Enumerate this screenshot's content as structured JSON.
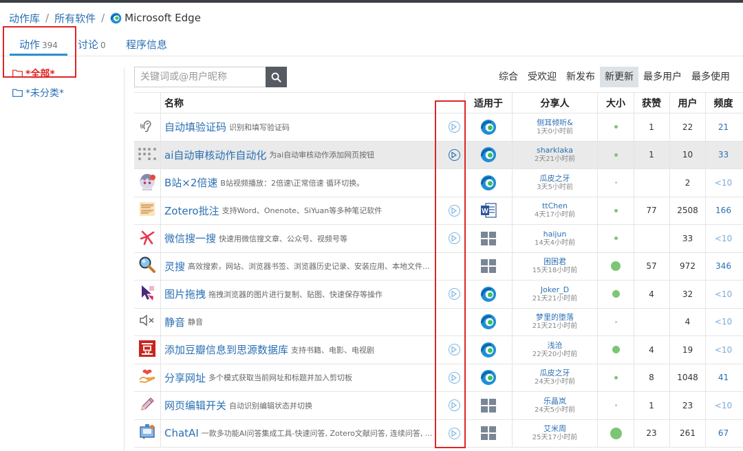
{
  "breadcrumb": {
    "root": "动作库",
    "mid": "所有软件",
    "current": "Microsoft Edge",
    "sep": "/"
  },
  "tabs": [
    {
      "label": "动作",
      "count": "394"
    },
    {
      "label": "讨论",
      "count": "0"
    },
    {
      "label": "程序信息",
      "count": ""
    }
  ],
  "sidebar": {
    "all": "*全部*",
    "uncategorized": "*未分类*"
  },
  "search": {
    "placeholder": "关键词或@用户昵称"
  },
  "sorts": [
    "综合",
    "受欢迎",
    "新发布",
    "新更新",
    "最多用户",
    "最多使用"
  ],
  "active_sort": "新更新",
  "headers": {
    "name": "名称",
    "for": "适用于",
    "sharer": "分享人",
    "size": "大小",
    "likes": "获赞",
    "users": "用户",
    "freq": "频度"
  },
  "colors": {
    "link": "#2a6fb3",
    "highlight": "#e02424",
    "dot": "#7cc576"
  },
  "rows": [
    {
      "icon": "ear-icon",
      "title": "自动填验证码",
      "desc": "识别和填写验证码",
      "play": true,
      "app": "edge",
      "sharer": "侧耳倾听&",
      "time": "1天0小时前",
      "size": "small",
      "likes": "1",
      "users": "22",
      "freq": "21"
    },
    {
      "icon": "grid-dots-icon",
      "title": "ai自动审核动作自动化",
      "desc": "为ai自动审核动作添加网页按钮",
      "play": true,
      "app": "edge",
      "sharer": "sharklaka",
      "time": "2天21小时前",
      "size": "small",
      "likes": "1",
      "users": "10",
      "freq": "33"
    },
    {
      "icon": "anime-icon",
      "title": "B站×2倍速",
      "desc": "B站视频播放：2倍速\\正常倍速 循环切换。",
      "play": false,
      "app": "edge",
      "sharer": "瓜皮之牙",
      "time": "3天5小时前",
      "size": "tiny",
      "likes": "",
      "users": "2",
      "freq": "<10"
    },
    {
      "icon": "notes-icon",
      "title": "Zotero批注",
      "desc": "支持Word、Onenote、SiYuan等多种笔记软件",
      "play": true,
      "app": "word",
      "sharer": "ttChen",
      "time": "4天17小时前",
      "size": "small",
      "likes": "77",
      "users": "2508",
      "freq": "166"
    },
    {
      "icon": "wechat-search-icon",
      "title": "微信搜一搜",
      "desc": "快速用微信搜文章、公众号、视频号等",
      "play": true,
      "app": "windows",
      "sharer": "haijun",
      "time": "14天4小时前",
      "size": "small",
      "likes": "",
      "users": "33",
      "freq": "<10"
    },
    {
      "icon": "magnifier-icon",
      "title": "灵搜",
      "desc": "高效搜索，网站、浏览器书签、浏览器历史记录、安装应用、本地文件...",
      "play": false,
      "app": "windows",
      "sharer": "困困君",
      "time": "15天18小时前",
      "size": "large",
      "likes": "57",
      "users": "972",
      "freq": "346"
    },
    {
      "icon": "cursor-icon",
      "title": "图片拖拽",
      "desc": "拖拽浏览器的图片进行复制、贴图、快速保存等操作",
      "play": true,
      "app": "edge",
      "sharer": "Joker_D",
      "time": "21天21小时前",
      "size": "medium",
      "likes": "4",
      "users": "32",
      "freq": "<10"
    },
    {
      "icon": "mute-icon",
      "title": "静音",
      "desc": "静音",
      "play": false,
      "app": "edge",
      "sharer": "梦里的堕落",
      "time": "21天21小时前",
      "size": "tiny",
      "likes": "",
      "users": "4",
      "freq": "<10"
    },
    {
      "icon": "douban-icon",
      "title": "添加豆瓣信息到思源数据库",
      "desc": "支持书籍、电影、电视剧",
      "play": true,
      "app": "edge",
      "sharer": "浅沧",
      "time": "22天20小时前",
      "size": "medium",
      "likes": "4",
      "users": "19",
      "freq": "<10"
    },
    {
      "icon": "share-heart-icon",
      "title": "分享网址",
      "desc": "多个模式获取当前网址和标题并加入剪切板",
      "play": true,
      "app": "edge",
      "sharer": "瓜皮之牙",
      "time": "24天3小时前",
      "size": "small",
      "likes": "8",
      "users": "1048",
      "freq": "41"
    },
    {
      "icon": "pencil-icon",
      "title": "网页编辑开关",
      "desc": "自动识别编辑状态并切换",
      "play": true,
      "app": "windows",
      "sharer": "乐晶岚",
      "time": "24天5小时前",
      "size": "tiny",
      "likes": "1",
      "users": "23",
      "freq": "<10"
    },
    {
      "icon": "chatai-icon",
      "title": "ChatAI",
      "desc": "一款多功能AI问答集成工具-快速问答, Zotero文献问答, 连续问答, ...",
      "play": true,
      "app": "windows",
      "sharer": "艾米周",
      "time": "25天17小时前",
      "size": "xlarge",
      "likes": "23",
      "users": "261",
      "freq": "67"
    }
  ]
}
